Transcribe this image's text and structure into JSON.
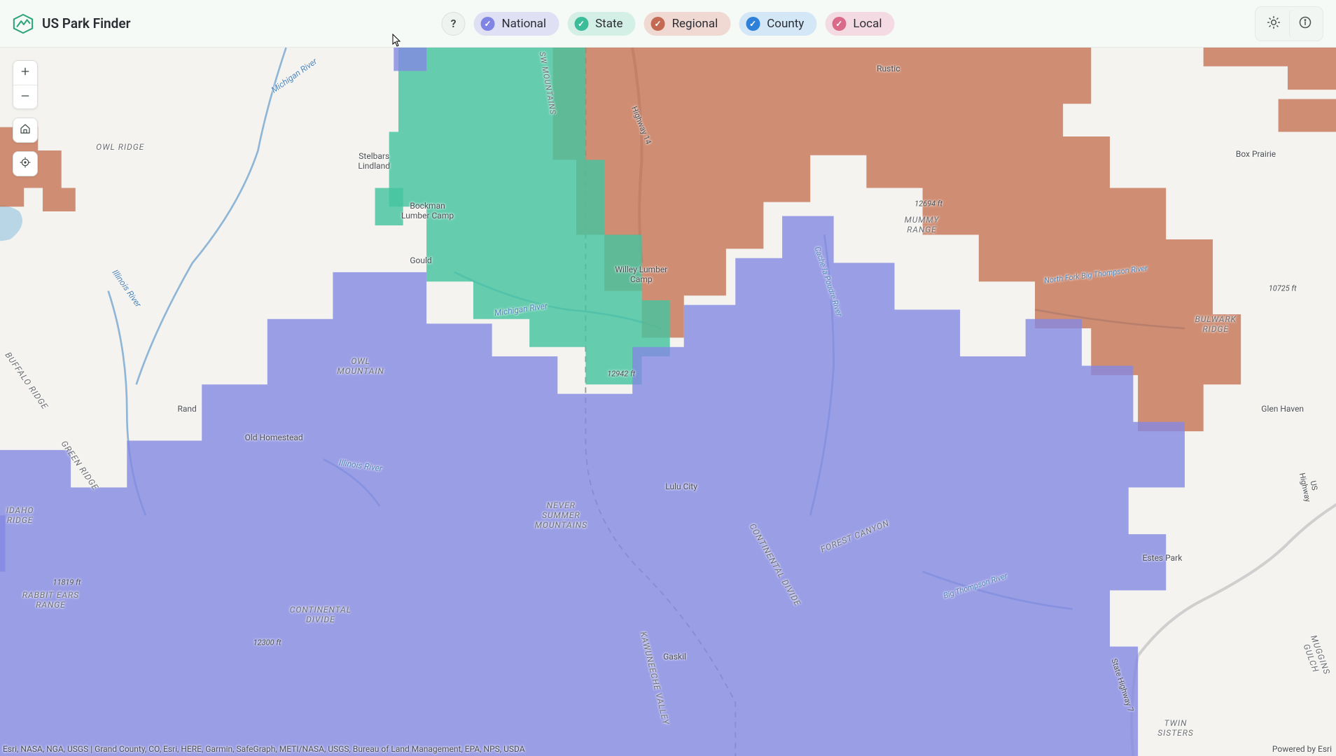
{
  "app": {
    "title": "US Park Finder"
  },
  "filters": {
    "national": "National",
    "state": "State",
    "regional": "Regional",
    "county": "County",
    "local": "Local"
  },
  "colors": {
    "national": "#8085e3",
    "state": "#3bbd9a",
    "regional": "#c46a52",
    "county": "#2e80d8",
    "local": "#d96a89",
    "national_fill": "#8388e2",
    "state_fill": "#46c4a0",
    "regional_fill": "#c4704f"
  },
  "attribution": "Esri, NASA, NGA, USGS | Grand County, CO, Esri, HERE, Garmin, SafeGraph, METI/NASA, USGS, Bureau of Land Management, EPA, NPS, USDA",
  "powered_by": "Powered by Esri",
  "labels": {
    "owl_ridge": "OWL RIDGE",
    "stelbars": "Stelbars\nLindland",
    "bockman": "Bockman\nLumber Camp",
    "gould": "Gould",
    "rand": "Rand",
    "old_homestead": "Old Homestead",
    "owl_mountain": "OWL\nMOUNTAIN",
    "never_summer": "NEVER\nSUMMER\nMOUNTAINS",
    "continental": "CONTINENTAL\nDIVIDE",
    "continental2": "CONTINENTAL DIVIDE",
    "rabbit_ears": "RABBIT EARS\nRANGE",
    "idaho_ridge": "IDAHO\nRIDGE",
    "buffalo_ridge": "BUFFALO RIDGE",
    "willey": "Willey Lumber\nCamp",
    "lulu": "Lulu City",
    "gaskil": "Gaskil",
    "rustic": "Rustic",
    "mummy": "MUMMY\nRANGE",
    "forest_canyon": "FOREST CANYON",
    "kawuneeche": "KAWUNEECHE VALLEY",
    "box_prairie": "Box Prairie",
    "glen_haven": "Glen Haven",
    "estes": "Estes Park",
    "bulwark": "BULWARK\nRIDGE",
    "twin_sisters": "TWIN\nSISTERS",
    "muggins": "MUGGINS GULCH",
    "green_ridge": "GREEN RIDGE",
    "michigan_r": "Michigan River",
    "michigan_r2": "Michigan River",
    "illinois_r": "Illinois River",
    "illinois_r2": "Illinois River",
    "poudre_r": "Cache la Poudre River",
    "bigthompson_r": "Big Thompson River",
    "nfork_bt_r": "North Fork Big Thompson River",
    "hwy14": "Highway 14",
    "ushwy": "US Highway",
    "statehwy": "State Highway 7",
    "elev_12694": "12694 ft",
    "elev_12942": "12942 ft",
    "elev_11819": "11819 ft",
    "elev_12300": "12300 ft",
    "elev_10725": "10725 ft",
    "sw_mountains": "SW MOUNTAINS"
  }
}
